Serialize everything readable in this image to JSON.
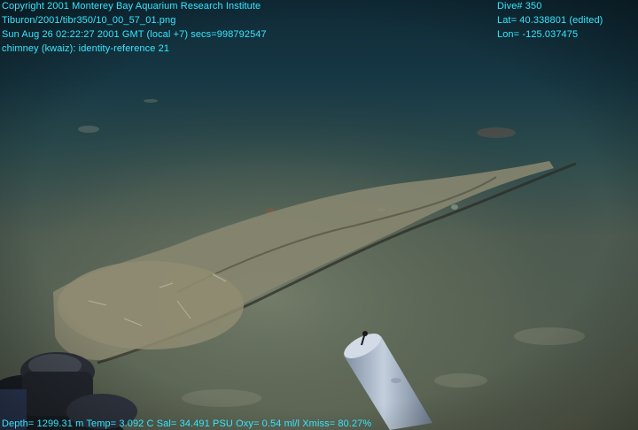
{
  "overlay": {
    "top_left": [
      "Copyright 2001 Monterey Bay Aquarium Research Institute",
      "Tiburon/2001/tibr350/10_00_57_01.png",
      "Sun Aug 26 02:22:27 2001 GMT (local +7)  secs=998792547",
      "chimney (kwaiz): identity-reference 21"
    ],
    "top_right": [
      "Dive# 350",
      "Lat= 40.338801 (edited)",
      "Lon= -125.037475"
    ],
    "bottom": "Depth= 1299.31 m  Temp= 3.092 C  Sal= 34.491 PSU  Oxy= 0.54 ml/l  Xmiss= 80.27%"
  },
  "colors": {
    "overlay_text": "#35e6ff",
    "water": "#12303c",
    "sediment": "#6f7a63",
    "chimney": "#8e8c72"
  },
  "scene": {
    "description_icons": [
      "seafloor-sediment",
      "chimney-structure",
      "sampling-tube",
      "rov-equipment"
    ]
  }
}
